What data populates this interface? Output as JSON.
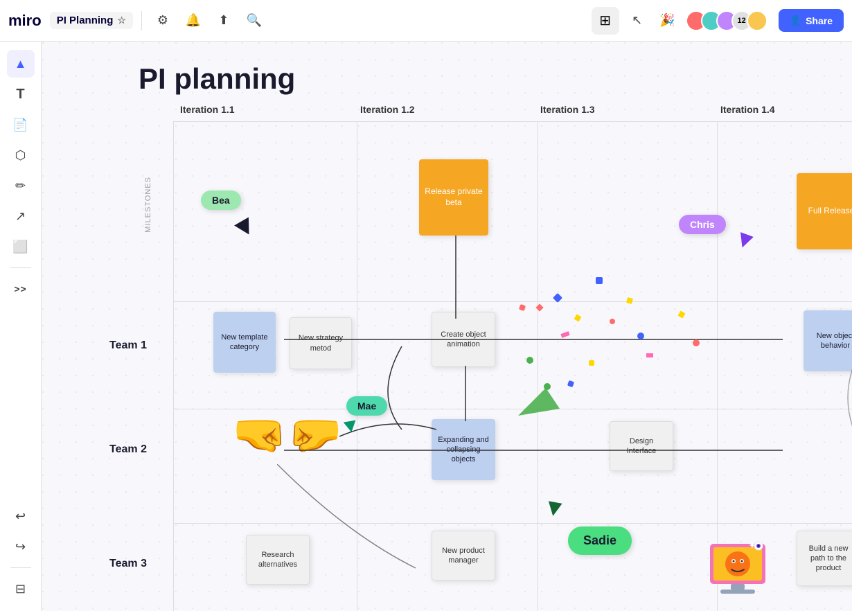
{
  "app": {
    "logo": "miro",
    "board_title": "PI Planning",
    "share_label": "Share"
  },
  "toolbar": {
    "tools": [
      "cursor",
      "text",
      "note",
      "shape",
      "pen",
      "arrow",
      "frame",
      "more"
    ],
    "undo_label": "↩",
    "redo_label": "↪"
  },
  "canvas": {
    "page_title": "PI planning",
    "milestones_label": "Milestones",
    "iterations": [
      "Iteration 1.1",
      "Iteration 1.2",
      "Iteration 1.3",
      "Iteration 1.4"
    ],
    "teams": [
      "Team 1",
      "Team 2",
      "Team 3"
    ],
    "online_count": "12"
  },
  "stickies": {
    "release_private_beta": "Release private beta",
    "full_release": "Full Release",
    "new_template_category": "New template category",
    "new_strategy_method": "New strategy metod",
    "create_object_animation": "Create object animation",
    "new_object_behavior": "New object behavior",
    "expanding_collapsing": "Expanding and collapsing objects",
    "design_interface": "Design Interface",
    "research_alternatives": "Research alternatives",
    "new_product_manager": "New product manager",
    "build_new_path": "Build a new path to the product"
  },
  "badges": {
    "bea": {
      "label": "Bea",
      "color": "#9de8b0"
    },
    "mae": {
      "label": "Mae",
      "color": "#4dd9ac"
    },
    "chris": {
      "label": "Chris",
      "color": "#c084fc"
    },
    "sadie": {
      "label": "Sadie",
      "color": "#4ade80"
    }
  },
  "colors": {
    "orange_sticky": "#f5a623",
    "blue_sticky": "#bdd0f0",
    "light_blue_sticky": "#c5d8f0",
    "gray_sticky": "#f0f0f0",
    "share_btn": "#4262ff",
    "team1_line": "#1a1a2e",
    "team2_line": "#1a1a2e"
  }
}
